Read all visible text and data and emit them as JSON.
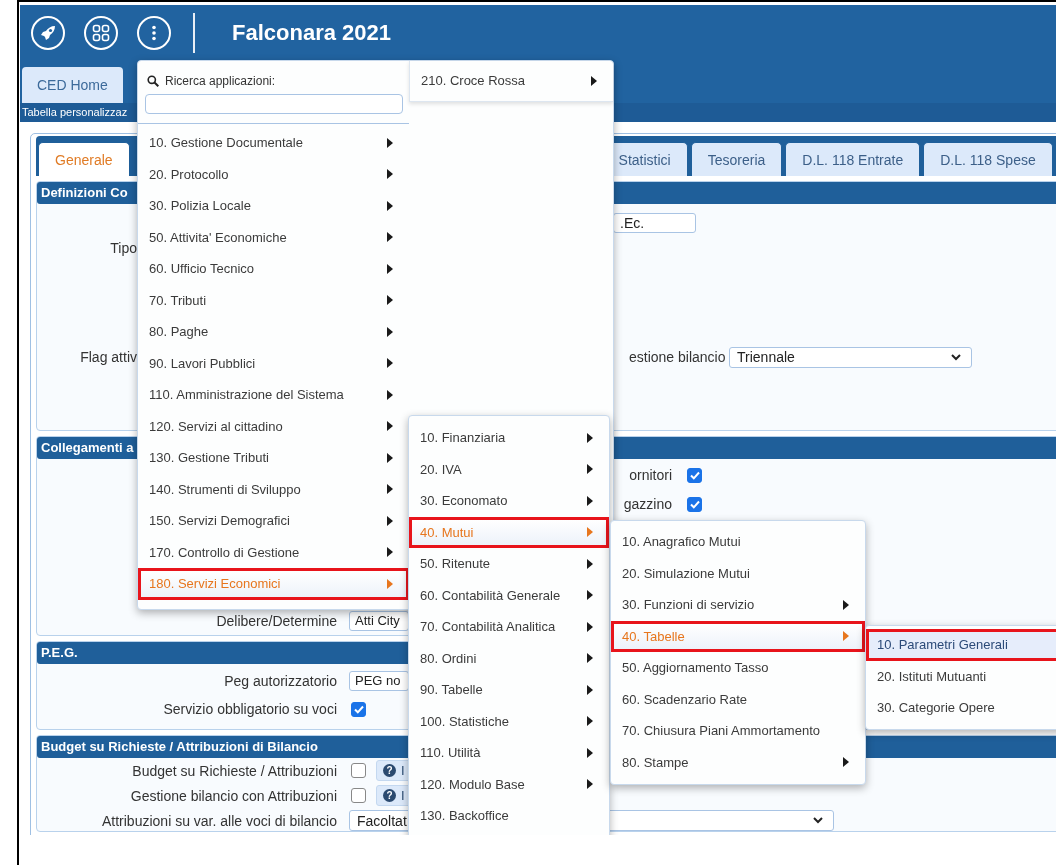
{
  "header": {
    "title": "Falconara 2021"
  },
  "top_tabs": [
    {
      "label": "CED Home",
      "selected": false
    }
  ],
  "info_bar": {
    "text": "Tabella personalizzaz"
  },
  "page_tabs": [
    {
      "label": "Generale",
      "selected": true
    },
    {
      "label": "Statistici",
      "selected": false
    },
    {
      "label": "Tesoreria",
      "selected": false
    },
    {
      "label": "D.L. 118 Entrate",
      "selected": false
    },
    {
      "label": "D.L. 118 Spese",
      "selected": false
    }
  ],
  "sections": [
    {
      "title": "Definizioni Co",
      "rows": [
        {
          "right": {
            "controls": [
              {
                "kind": "field",
                "value": ".Ec."
              }
            ]
          }
        },
        {
          "left": {
            "label": "Tipo"
          }
        },
        {
          "left": {
            "label": "Flag attiv"
          },
          "right": {
            "label": "estione bilancio",
            "controls": [
              {
                "kind": "select",
                "value": "Triennale"
              }
            ]
          }
        }
      ]
    },
    {
      "title": "Collegamenti a",
      "rows": [
        {
          "right": {
            "label": "ornitori",
            "controls": [
              {
                "kind": "checkbox",
                "checked": true
              }
            ]
          }
        },
        {
          "right": {
            "label": "gazzino",
            "controls": [
              {
                "kind": "checkbox",
                "checked": true
              }
            ]
          }
        },
        {
          "left": {
            "label": "Delibere/Determine",
            "controls": [
              {
                "kind": "field",
                "value": "Atti City"
              }
            ]
          }
        }
      ]
    },
    {
      "title": "P.E.G.",
      "rows": [
        {
          "left": {
            "label": "Peg autorizzatorio",
            "controls": [
              {
                "kind": "field",
                "value": "PEG no"
              }
            ]
          }
        },
        {
          "left": {
            "label": "Servizio obbligatorio su voci",
            "controls": [
              {
                "kind": "checkbox",
                "checked": true
              }
            ]
          }
        }
      ]
    },
    {
      "title": "Budget su Richieste / Attribuzioni di Bilancio",
      "rows": [
        {
          "left": {
            "label": "Budget su Richieste / Attribuzioni",
            "controls": [
              {
                "kind": "checkbox",
                "checked": false
              },
              {
                "kind": "info_button",
                "icon_text": "?",
                "label": "I"
              }
            ]
          }
        },
        {
          "left": {
            "label": "Gestione bilancio con Attribuzioni",
            "controls": [
              {
                "kind": "checkbox",
                "checked": false
              },
              {
                "kind": "info_button",
                "icon_text": "?",
                "label": "I"
              }
            ]
          }
        },
        {
          "left": {
            "label": "Attribuzioni su var. alle voci di bilancio",
            "controls": [
              {
                "kind": "select",
                "value": "Facoltat"
              }
            ]
          }
        }
      ]
    }
  ],
  "app_menu": {
    "search_label": "Ricerca applicazioni:",
    "items": [
      {
        "label": "10. Gestione Documentale",
        "has_submenu": true,
        "selected": false
      },
      {
        "label": "20. Protocollo",
        "has_submenu": true,
        "selected": false
      },
      {
        "label": "30. Polizia Locale",
        "has_submenu": true,
        "selected": false
      },
      {
        "label": "50. Attivita' Economiche",
        "has_submenu": true,
        "selected": false
      },
      {
        "label": "60. Ufficio Tecnico",
        "has_submenu": true,
        "selected": false
      },
      {
        "label": "70. Tributi",
        "has_submenu": true,
        "selected": false
      },
      {
        "label": "80. Paghe",
        "has_submenu": true,
        "selected": false
      },
      {
        "label": "90. Lavori Pubblici",
        "has_submenu": true,
        "selected": false
      },
      {
        "label": "110. Amministrazione del Sistema",
        "has_submenu": true,
        "selected": false
      },
      {
        "label": "120. Servizi al cittadino",
        "has_submenu": true,
        "selected": false
      },
      {
        "label": "130. Gestione Tributi",
        "has_submenu": true,
        "selected": false
      },
      {
        "label": "140. Strumenti di Sviluppo",
        "has_submenu": true,
        "selected": false
      },
      {
        "label": "150. Servizi Demografici",
        "has_submenu": true,
        "selected": false
      },
      {
        "label": "170. Controllo di Gestione",
        "has_submenu": true,
        "selected": false
      },
      {
        "label": "180. Servizi Economici",
        "has_submenu": true,
        "selected": true
      }
    ],
    "extra_items": [
      {
        "label": "210. Croce Rossa",
        "has_submenu": true,
        "selected": false
      }
    ]
  },
  "submenus": [
    {
      "items": [
        {
          "label": "10. Finanziaria",
          "has_submenu": true,
          "selected": false
        },
        {
          "label": "20. IVA",
          "has_submenu": true,
          "selected": false
        },
        {
          "label": "30. Economato",
          "has_submenu": true,
          "selected": false
        },
        {
          "label": "40. Mutui",
          "has_submenu": true,
          "selected": true
        },
        {
          "label": "50. Ritenute",
          "has_submenu": true,
          "selected": false
        },
        {
          "label": "60. Contabilità Generale",
          "has_submenu": true,
          "selected": false
        },
        {
          "label": "70. Contabilità Analitica",
          "has_submenu": true,
          "selected": false
        },
        {
          "label": "80. Ordini",
          "has_submenu": true,
          "selected": false
        },
        {
          "label": "90. Tabelle",
          "has_submenu": true,
          "selected": false
        },
        {
          "label": "100. Statistiche",
          "has_submenu": true,
          "selected": false
        },
        {
          "label": "110. Utilità",
          "has_submenu": true,
          "selected": false
        },
        {
          "label": "120. Modulo Base",
          "has_submenu": true,
          "selected": false
        },
        {
          "label": "130. Backoffice",
          "has_submenu": false,
          "selected": false
        }
      ]
    },
    {
      "items": [
        {
          "label": "10. Anagrafico Mutui",
          "has_submenu": false,
          "selected": false
        },
        {
          "label": "20. Simulazione Mutui",
          "has_submenu": false,
          "selected": false
        },
        {
          "label": "30. Funzioni di servizio",
          "has_submenu": true,
          "selected": false
        },
        {
          "label": "40. Tabelle",
          "has_submenu": true,
          "selected": true
        },
        {
          "label": "50. Aggiornamento Tasso",
          "has_submenu": false,
          "selected": false
        },
        {
          "label": "60. Scadenzario Rate",
          "has_submenu": false,
          "selected": false
        },
        {
          "label": "70. Chiusura Piani Ammortamento",
          "has_submenu": false,
          "selected": false
        },
        {
          "label": "80. Stampe",
          "has_submenu": true,
          "selected": false
        }
      ]
    },
    {
      "items": [
        {
          "label": "10. Parametri Generali",
          "has_submenu": false,
          "selected": true
        },
        {
          "label": "20. Istituti Mutuanti",
          "has_submenu": false,
          "selected": false
        },
        {
          "label": "30. Categorie Opere",
          "has_submenu": false,
          "selected": false
        }
      ]
    }
  ]
}
